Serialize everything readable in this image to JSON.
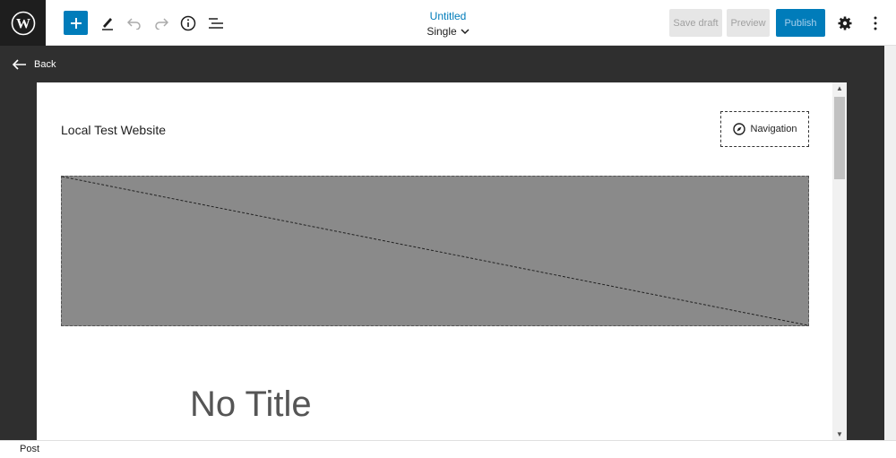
{
  "toolbar": {
    "document_title": "Untitled",
    "template_name": "Single",
    "save_draft_label": "Save draft",
    "preview_label": "Preview",
    "publish_label": "Publish"
  },
  "sidebar": {
    "back_label": "Back"
  },
  "canvas": {
    "site_title": "Local Test Website",
    "navigation_label": "Navigation",
    "post_title_placeholder": "No Title"
  },
  "footer": {
    "breadcrumb": "Post"
  },
  "colors": {
    "accent": "#007cba",
    "dark_bg": "#2f2f2f",
    "placeholder_bg": "#8a8a8a"
  },
  "icons": [
    "wordpress-icon",
    "plus-icon",
    "pencil-icon",
    "undo-icon",
    "redo-icon",
    "info-icon",
    "list-view-icon",
    "chevron-down-icon",
    "gear-icon",
    "more-vertical-icon",
    "arrow-left-icon",
    "compass-icon"
  ]
}
